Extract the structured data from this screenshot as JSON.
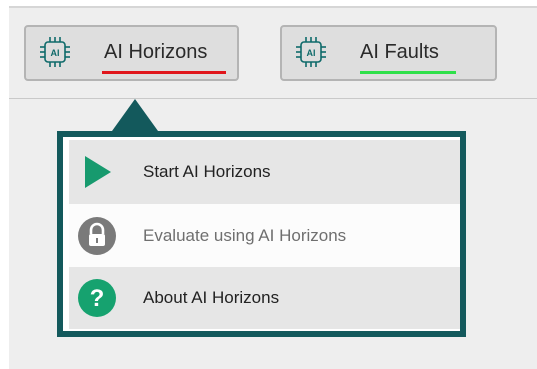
{
  "toolbar": {
    "buttons": [
      {
        "label": "AI Horizons",
        "icon": "ai-chip-icon",
        "chip_text": "AI",
        "underline_color": "#e0161c"
      },
      {
        "label": "AI Faults",
        "icon": "ai-chip-icon",
        "chip_text": "AI",
        "underline_color": "#2fe04a"
      }
    ]
  },
  "menu": {
    "accent_color": "#13595c",
    "items": [
      {
        "label": "Start AI Horizons",
        "icon": "play-icon",
        "enabled": true
      },
      {
        "label": "Evaluate using AI Horizons",
        "icon": "lock-icon",
        "enabled": false
      },
      {
        "label": "About AI Horizons",
        "icon": "help-icon",
        "enabled": true
      }
    ]
  }
}
